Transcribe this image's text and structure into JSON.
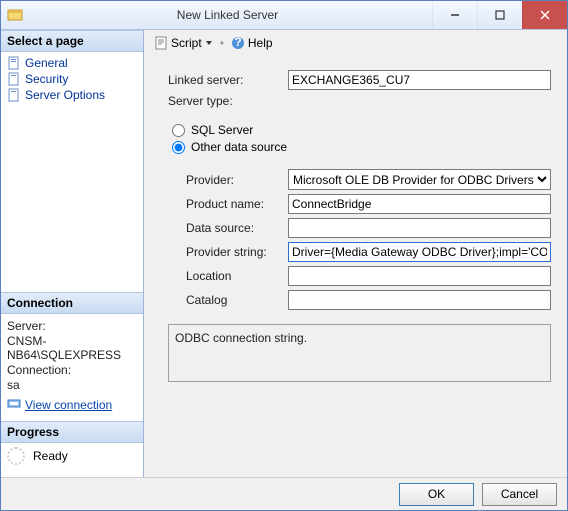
{
  "window": {
    "title": "New Linked Server"
  },
  "left": {
    "select_page": "Select a page",
    "items": [
      "General",
      "Security",
      "Server Options"
    ],
    "connection": {
      "header": "Connection",
      "server_label": "Server:",
      "server_value": "CNSM-NB64\\SQLEXPRESS",
      "conn_label": "Connection:",
      "conn_value": "sa",
      "view_link": "View connection "
    },
    "progress": {
      "header": "Progress",
      "status": "Ready"
    }
  },
  "toolbar": {
    "script": "Script",
    "help": "Help"
  },
  "form": {
    "linked_server_label": "Linked server:",
    "linked_server_value": "EXCHANGE365_CU7",
    "server_type_label": "Server type:",
    "radio_sql": "SQL Server",
    "radio_other": "Other data source",
    "provider_label": "Provider:",
    "provider_value": "Microsoft OLE DB Provider for ODBC Drivers",
    "product_label": "Product name:",
    "product_value": "ConnectBridge",
    "datasource_label": "Data source:",
    "datasource_value": "",
    "providerstring_label": "Provider string:",
    "providerstring_value": "Driver={Media Gateway ODBC Driver};impl='CORE",
    "location_label": "Location",
    "location_value": "",
    "catalog_label": "Catalog",
    "catalog_value": ""
  },
  "hint": "ODBC connection string.",
  "footer": {
    "ok": "OK",
    "cancel": "Cancel"
  }
}
